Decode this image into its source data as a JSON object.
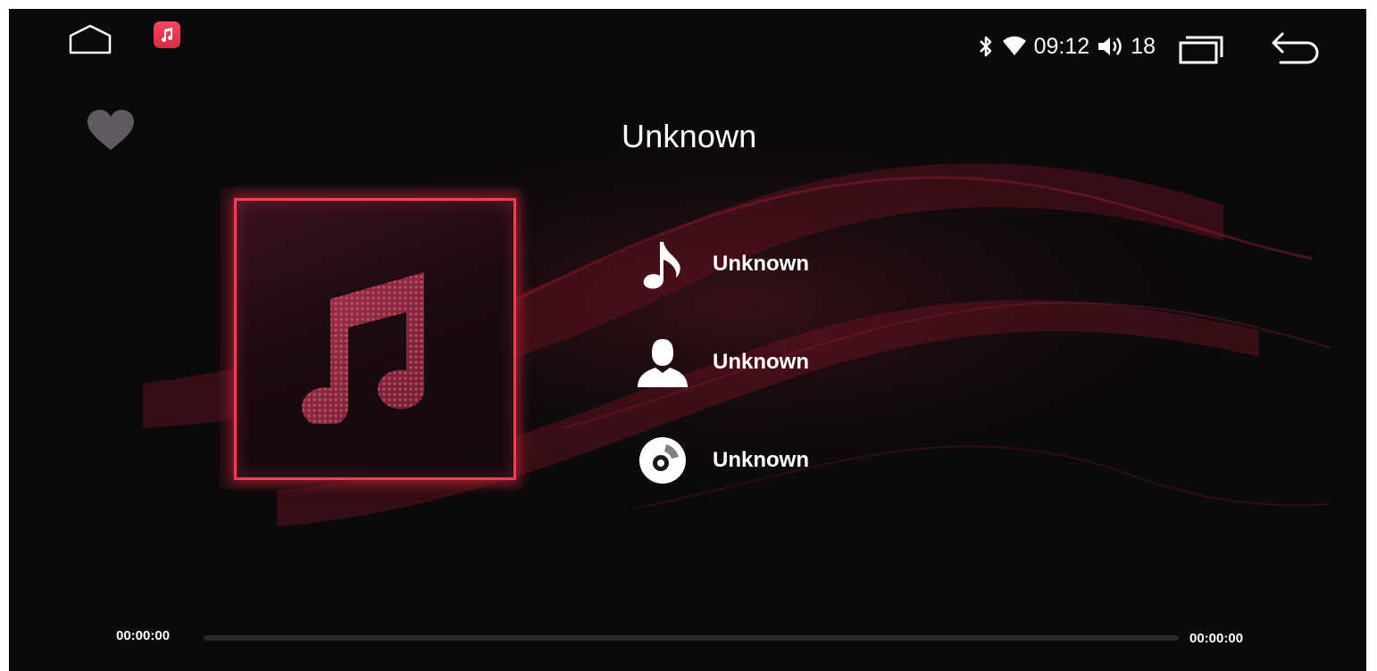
{
  "status": {
    "time": "09:12",
    "volume": "18",
    "icons": [
      "bluetooth-icon",
      "wifi-icon",
      "volume-icon"
    ]
  },
  "nav": {
    "home_icon": "home-icon",
    "recents_icon": "recents-icon",
    "back_icon": "back-arrow-icon",
    "app_icon": "music-app-icon"
  },
  "player": {
    "title": "Unknown",
    "song": "Unknown",
    "artist": "Unknown",
    "album": "Unknown",
    "elapsed": "00:00:00",
    "duration": "00:00:00",
    "progress": 0,
    "favorite_icon": "heart-icon"
  },
  "colors": {
    "accent": "#d92c44",
    "background": "#0b0a0b",
    "text": "#ffffff"
  }
}
